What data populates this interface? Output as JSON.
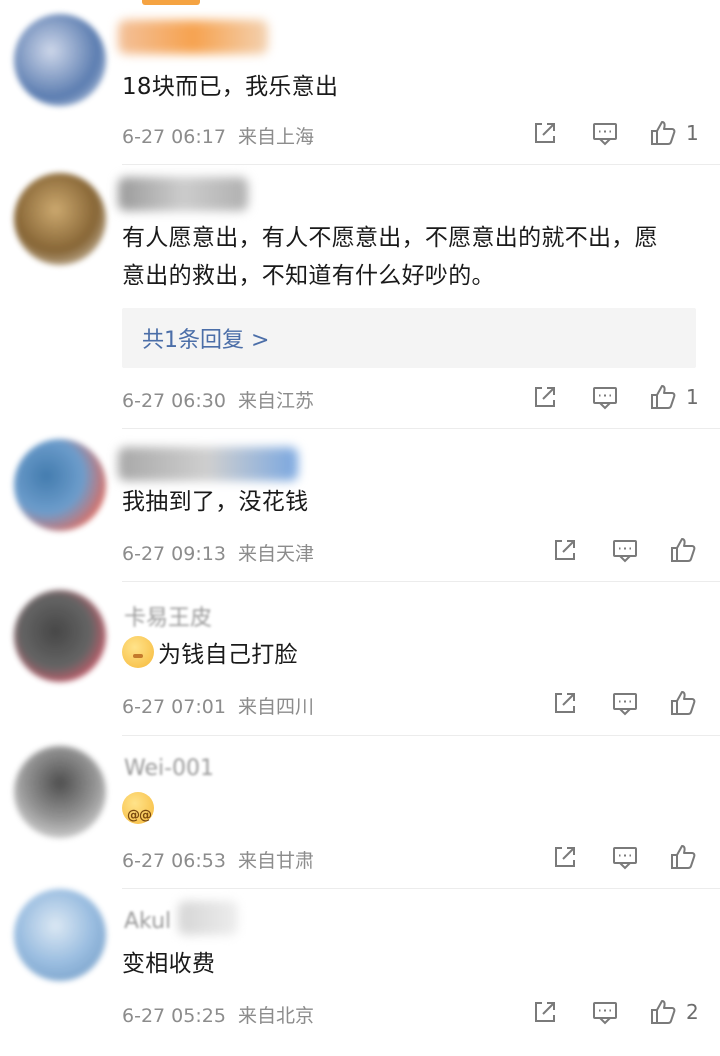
{
  "comments": [
    {
      "text": "18块而已，我乐意出",
      "date": "6-27 06:17",
      "location": "来自上海",
      "likes": "1",
      "avatar_colors": [
        "#4a6fa8",
        "#c9d3e8"
      ],
      "name_colors": [
        "#f3c19a",
        "#f6a24f"
      ]
    },
    {
      "text": "有人愿意出，有人不愿意出，不愿意出的就不出，愿意出的救出，不知道有什么好吵的。",
      "reply_label": "共1条回复 >",
      "date": "6-27 06:30",
      "location": "来自江苏",
      "likes": "1",
      "avatar_colors": [
        "#7a5520",
        "#c7a060"
      ],
      "name_colors": [
        "#9a9a9a",
        "#cccccc"
      ]
    },
    {
      "text": "我抽到了，没花钱",
      "date": "6-27 09:13",
      "location": "来自天津",
      "likes": "",
      "avatar_colors": [
        "#2f6ea6",
        "#e25a4a"
      ],
      "name_colors": [
        "#a8a8a8",
        "#7aa7e0"
      ]
    },
    {
      "name": "卡易王皮",
      "text": "为钱自己打脸",
      "date": "6-27 07:01",
      "location": "来自四川",
      "likes": "",
      "avatar_colors": [
        "#333333",
        "#d2475a"
      ],
      "name_colors": [
        "#cfcfcf",
        "#e5e5e5"
      ]
    },
    {
      "name": "Wei-001",
      "text": "",
      "date": "6-27 06:53",
      "location": "来自甘肃",
      "likes": "",
      "avatar_colors": [
        "#6b6b6b",
        "#c9c9c9"
      ],
      "name_colors": [
        "#8e8e8e",
        "#8fb6ea"
      ]
    },
    {
      "name": "Akul",
      "text": "变相收费",
      "date": "6-27 05:25",
      "location": "来自北京",
      "likes": "2",
      "avatar_colors": [
        "#8fb6dd",
        "#d8e6f3"
      ],
      "name_colors": [
        "#d5d5d5",
        "#ededed"
      ]
    }
  ],
  "icons": {
    "share": "share-icon",
    "comment": "comment-icon",
    "like": "like-icon"
  }
}
